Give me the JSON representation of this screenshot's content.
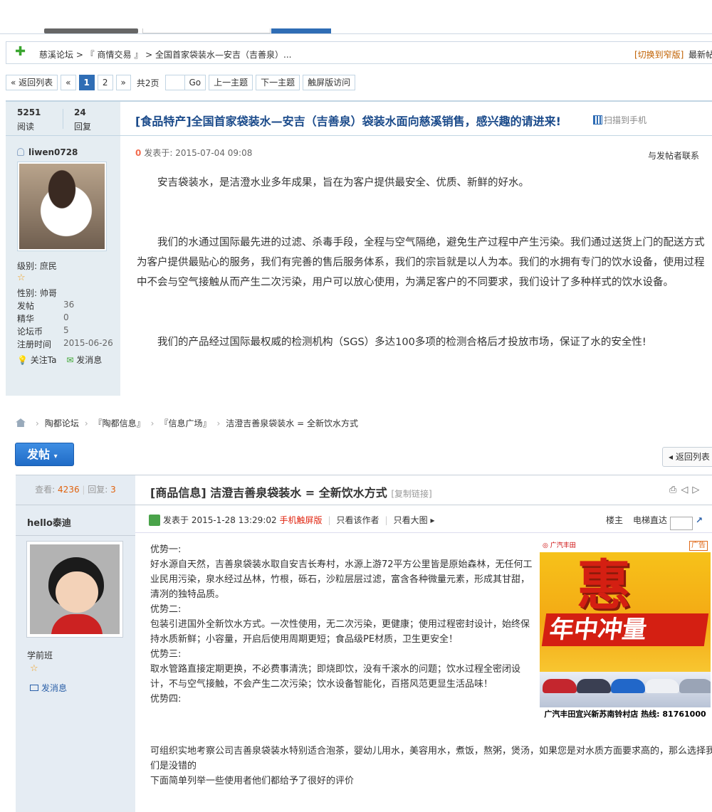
{
  "top": {
    "breadcrumb": "慈溪论坛 > 『 商情交易 』 > 全国首家袋装水—安吉（吉善泉）...",
    "switch_wide": "[切换到窄版]",
    "newest": "最新帖",
    "pager": {
      "back": "« 返回列表",
      "prev": "«",
      "pages": [
        "1",
        "2"
      ],
      "next": "»",
      "total": "共2页",
      "go": "Go",
      "prev_topic": "上一主题",
      "next_topic": "下一主题",
      "touch": "触屏版访问"
    },
    "stats": {
      "views": "5251",
      "views_label": "阅读",
      "replies": "24",
      "replies_label": "回复"
    },
    "title": "[食品特产]全国首家袋装水—安吉（吉善泉）袋装水面向慈溪销售，感兴趣的请进来!",
    "scan": "扫描到手机",
    "user": {
      "name": "liwen0728",
      "level": "级别: 庶民",
      "gender": "性别: 帅哥",
      "rows": [
        {
          "k": "发帖",
          "v": "36"
        },
        {
          "k": "精华",
          "v": "0"
        },
        {
          "k": "论坛币",
          "v": "5"
        },
        {
          "k": "注册时间",
          "v": "2015-06-26"
        }
      ],
      "follow": "关注Ta",
      "message": "发消息"
    },
    "post": {
      "floor": "0",
      "posted": "发表于: 2015-07-04 09:08",
      "contact": "与发帖者联系",
      "paragraphs": [
        "安吉袋装水，是洁澄水业多年成果，旨在为客户提供最安全、优质、新鲜的好水。",
        "我们的水通过国际最先进的过滤、杀毒手段，全程与空气隔绝，避免生产过程中产生污染。我们通过送货上门的配送方式为客户提供最贴心的服务，我们有完善的售后服务体系，我们的宗旨就是以人为本。我们的水拥有专门的饮水设备，使用过程中不会与空气接触从而产生二次污染，用户可以放心使用，为满足客户的不同要求，我们设计了多种样式的饮水设备。",
        "我们的产品经过国际最权威的检测机构（SGS）多达100多项的检测合格后才投放市场，保证了水的安全性!"
      ]
    }
  },
  "bottom": {
    "breadcrumb": [
      "陶都论坛",
      "『陶都信息』",
      "『信息广场』",
      "洁澄吉善泉袋装水 = 全新饮水方式"
    ],
    "post_button": "发帖",
    "back_button": "返回列表",
    "stats": {
      "views_label": "查看:",
      "views": "4236",
      "replies_label": "回复:",
      "replies": "3"
    },
    "title": "[商品信息] 洁澄吉善泉袋装水 = 全新饮水方式",
    "copy_link": "[复制链接]",
    "user": {
      "name": "hello泰迪",
      "rank": "学前班",
      "message": "发消息"
    },
    "meta": {
      "posted": "发表于 2015-1-28 13:29:02",
      "mobile": "手机触屏版",
      "only_author": "只看该作者",
      "big_image": "只看大图",
      "floor": "楼主",
      "elevator": "电梯直达"
    },
    "content": [
      "优势一:",
      "好水源自天然，吉善泉袋装水取自安吉长寿村，水源上游72平方公里皆是原始森林，无任何工业民用污染，泉水经过丛林，竹根，砾石，沙粒层层过滤，富含各种微量元素，形成其甘甜，清冽的独特品质。",
      "优势二:",
      "包装引进国外全新饮水方式。一次性使用，无二次污染，更健康；使用过程密封设计，始终保持水质新鲜；小容量，开启后使用周期更短；食品级PE材质，卫生更安全！",
      "优势三:",
      "取水管路直接定期更换，不必费事清洗；即烧即饮，没有千滚水的问题；饮水过程全密闭设计，不与空气接触，不会产生二次污染；饮水设备智能化，百搭风范更显生活品味！",
      "优势四:"
    ],
    "content_wide": [
      "可组织实地考察公司吉善泉袋装水特别适合泡茶，婴幼儿用水，美容用水，煮饭，熬粥，煲汤，如果您是对水质方面要求高的，那么选择我们是没错的",
      "下面简单列举一些使用者他们都给予了很好的评价"
    ],
    "ad": {
      "brand": "广汽丰田",
      "tag": "广告",
      "big_char": "惠",
      "banner": "年中冲量",
      "footer": "广汽丰田宜兴新苏南铃村店 热线: 81761000"
    }
  },
  "colors": {
    "accent": "#2f6db5",
    "link_title": "#1a4a8a",
    "panel_bg": "#e5edf2",
    "num_orange": "#e0620e"
  }
}
